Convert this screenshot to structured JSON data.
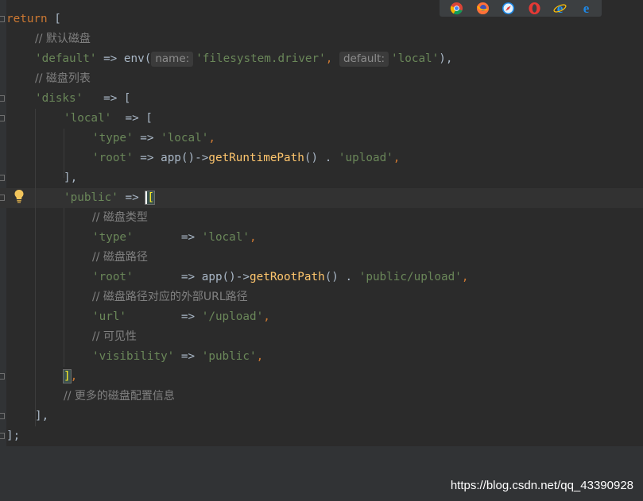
{
  "code": {
    "l1": {
      "kw": "return",
      "rest": " ["
    },
    "l2": {
      "comment": "// 默认磁盘"
    },
    "l3": {
      "key": "'default'",
      "arrow": " => ",
      "fn": "env(",
      "hint1": "name:",
      "arg1": "'filesystem.driver'",
      "sep": ", ",
      "hint2": "default:",
      "arg2": "'local'",
      "end": "),"
    },
    "l4": {
      "comment": "// 磁盘列表"
    },
    "l5": {
      "key": "'disks'",
      "arrow": "   => ["
    },
    "l6": {
      "key": "'local'",
      "arrow": "  => ["
    },
    "l7": {
      "key": "'type'",
      "arrow": " => ",
      "val": "'local'",
      "end": ","
    },
    "l8": {
      "key": "'root'",
      "arrow": " => ",
      "fn1": "app()->",
      "method": "getRuntimePath",
      "mid": "() . ",
      "val": "'upload'",
      "end": ","
    },
    "l9": {
      "text": "],"
    },
    "l10": {
      "key": "'public'",
      "arrow": " => ",
      "bracket": "["
    },
    "l11": {
      "comment": "// 磁盘类型"
    },
    "l12": {
      "key": "'type'",
      "arrow": "       => ",
      "val": "'local'",
      "end": ","
    },
    "l13": {
      "comment": "// 磁盘路径"
    },
    "l14": {
      "key": "'root'",
      "arrow": "       => ",
      "fn1": "app()->",
      "method": "getRootPath",
      "mid": "() . ",
      "val": "'public/upload'",
      "end": ","
    },
    "l15": {
      "comment": "// 磁盘路径对应的外部URL路径"
    },
    "l16": {
      "key": "'url'",
      "arrow": "        => ",
      "val": "'/upload'",
      "end": ","
    },
    "l17": {
      "comment": "// 可见性"
    },
    "l18": {
      "key": "'visibility'",
      "arrow": " => ",
      "val": "'public'",
      "end": ","
    },
    "l19": {
      "bracket": "]",
      "end": ","
    },
    "l20": {
      "comment": "// 更多的磁盘配置信息"
    },
    "l21": {
      "text": "],"
    },
    "l22": {
      "text": "];"
    }
  },
  "browser_icons": [
    "chrome-icon",
    "firefox-icon",
    "safari-icon",
    "opera-icon",
    "ie-icon",
    "edge-icon"
  ],
  "watermark": "https://blog.csdn.net/qq_43390928",
  "colors": {
    "background": "#2b2b2b",
    "keyword": "#cc7832",
    "string": "#6a8759",
    "comment": "#808080",
    "method": "#ffc66d",
    "default_text": "#a9b7c6"
  }
}
